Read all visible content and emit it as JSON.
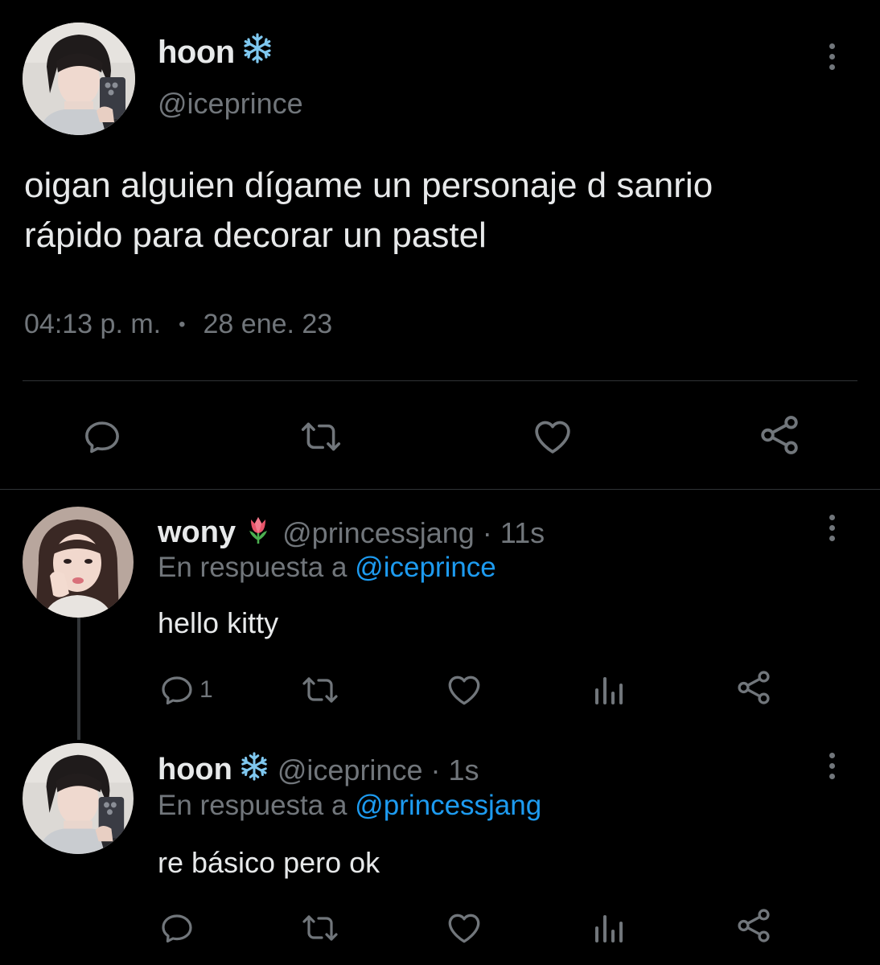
{
  "main_tweet": {
    "author_name": "hoon",
    "name_emoji": "snowflake",
    "handle": "@iceprince",
    "text_line1": "oigan alguien dígame un personaje d sanrio",
    "text_line2": "rápido para decorar un pastel",
    "time": "04:13 p. m.",
    "separator": "•",
    "date": "28 ene. 23",
    "actions": [
      "reply-icon",
      "retweet-icon",
      "like-icon",
      "share-icon"
    ]
  },
  "replies": [
    {
      "author_name": "wony",
      "name_emoji": "tulip",
      "handle": "@princessjang",
      "time": "· 11s",
      "reply_prefix": "En respuesta a",
      "reply_to": "@iceprince",
      "text": "hello kitty",
      "reply_count": "1",
      "actions": [
        "reply-icon",
        "retweet-icon",
        "like-icon",
        "analytics-icon",
        "share-icon"
      ]
    },
    {
      "author_name": "hoon",
      "name_emoji": "snowflake",
      "handle": "@iceprince",
      "time": "· 1s",
      "reply_prefix": "En respuesta a",
      "reply_to": "@princessjang",
      "text": "re básico pero ok",
      "reply_count": "",
      "actions": [
        "reply-icon",
        "retweet-icon",
        "like-icon",
        "analytics-icon",
        "share-icon"
      ]
    }
  ],
  "colors": {
    "background": "#000000",
    "text": "#e7e9ea",
    "secondary": "#71767b",
    "accent": "#1d9bf0",
    "divider": "#2f3336",
    "snowflake": "#7fc8f0"
  }
}
